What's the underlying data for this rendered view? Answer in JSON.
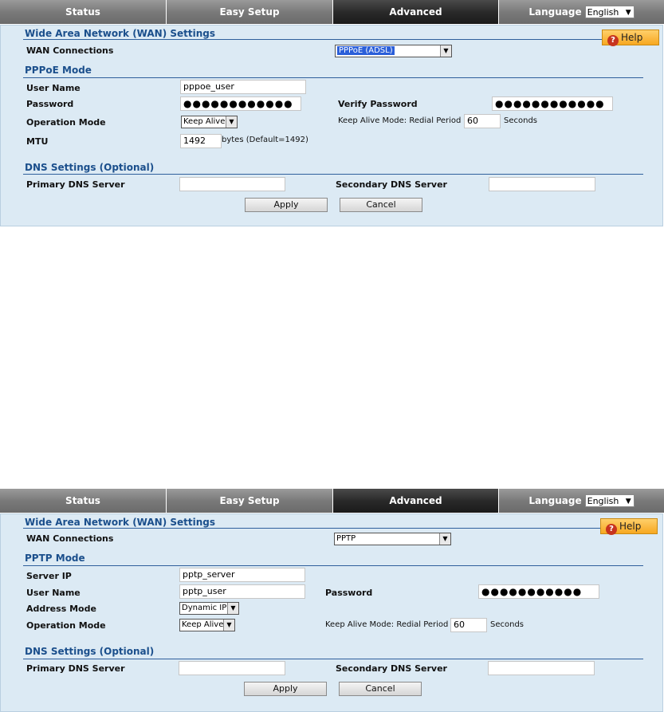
{
  "nav": {
    "status": "Status",
    "easy_setup": "Easy Setup",
    "advanced": "Advanced",
    "language": "Language",
    "language_value": "English"
  },
  "screen1": {
    "title": "Wide Area Network (WAN) Settings",
    "help": "Help",
    "wan_connections_label": "WAN Connections",
    "wan_connections_value": "PPPoE (ADSL)",
    "mode_title": "PPPoE Mode",
    "user_name_label": "User Name",
    "user_name_value": "pppoe_user",
    "password_label": "Password",
    "password_value": "●●●●●●●●●●●●",
    "verify_password_label": "Verify Password",
    "verify_password_value": "●●●●●●●●●●●●",
    "operation_mode_label": "Operation Mode",
    "operation_mode_value": "Keep Alive",
    "redial_label": "Keep Alive Mode: Redial Period",
    "redial_value": "60",
    "seconds": "Seconds",
    "mtu_label": "MTU",
    "mtu_value": "1492",
    "mtu_hint": "bytes (Default=1492)",
    "dns_title": "DNS Settings (Optional)",
    "primary_dns_label": "Primary DNS Server",
    "primary_dns_value": "",
    "secondary_dns_label": "Secondary DNS Server",
    "secondary_dns_value": "",
    "apply": "Apply",
    "cancel": "Cancel"
  },
  "screen2": {
    "title": "Wide Area Network (WAN) Settings",
    "help": "Help",
    "wan_connections_label": "WAN Connections",
    "wan_connections_value": "PPTP",
    "mode_title": "PPTP Mode",
    "server_ip_label": "Server IP",
    "server_ip_value": "pptp_server",
    "user_name_label": "User Name",
    "user_name_value": "pptp_user",
    "password_label": "Password",
    "password_value": "●●●●●●●●●●●",
    "address_mode_label": "Address Mode",
    "address_mode_value": "Dynamic IP",
    "operation_mode_label": "Operation Mode",
    "operation_mode_value": "Keep Alive",
    "redial_label": "Keep Alive Mode: Redial Period",
    "redial_value": "60",
    "seconds": "Seconds",
    "dns_title": "DNS Settings (Optional)",
    "primary_dns_label": "Primary DNS Server",
    "primary_dns_value": "",
    "secondary_dns_label": "Secondary DNS Server",
    "secondary_dns_value": "",
    "apply": "Apply",
    "cancel": "Cancel"
  }
}
